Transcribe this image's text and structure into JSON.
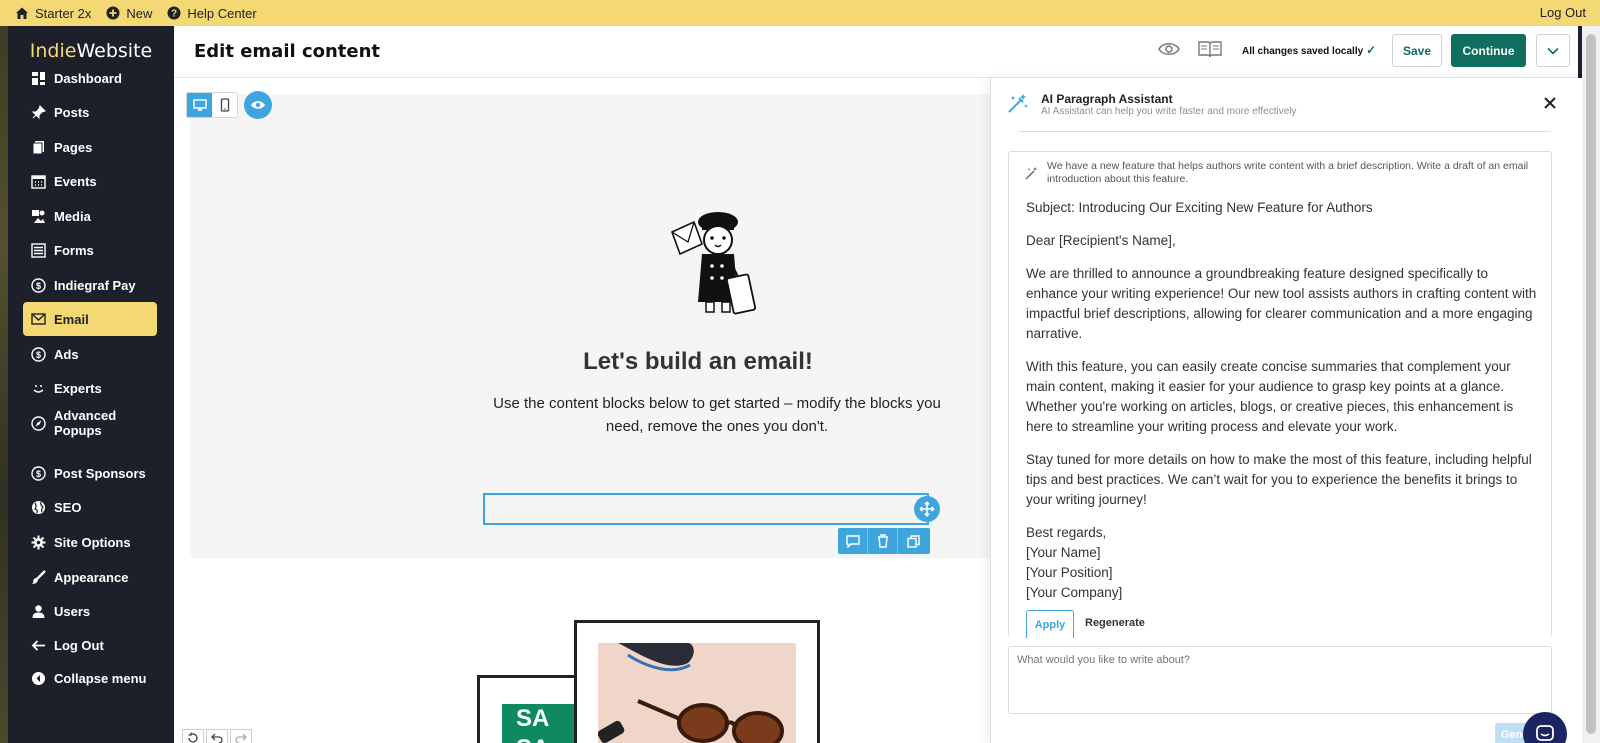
{
  "topbar": {
    "home_label": "Starter 2x",
    "new_label": "New",
    "help_label": "Help Center",
    "logout_label": "Log Out"
  },
  "brand": {
    "part1": "Indie",
    "part2": " Website"
  },
  "sidebar": {
    "items": [
      {
        "label": "Dashboard",
        "icon": "dashboard-icon"
      },
      {
        "label": "Posts",
        "icon": "pin-icon"
      },
      {
        "label": "Pages",
        "icon": "pages-icon"
      },
      {
        "label": "Events",
        "icon": "calendar-icon"
      },
      {
        "label": "Media",
        "icon": "media-icon"
      },
      {
        "label": "Forms",
        "icon": "forms-icon"
      },
      {
        "label": "Indiegraf Pay",
        "icon": "dollar-icon"
      },
      {
        "label": "Email",
        "icon": "envelope-icon",
        "active": true
      },
      {
        "label": "Ads",
        "icon": "dollar-icon"
      },
      {
        "label": "Experts",
        "icon": "smile-icon"
      },
      {
        "label": "Advanced\nPopups",
        "icon": "compass-icon"
      },
      {
        "label": "Post Sponsors",
        "icon": "dollar-icon"
      },
      {
        "label": "SEO",
        "icon": "globe-icon"
      },
      {
        "label": "Site Options",
        "icon": "gear-icon"
      },
      {
        "label": "Appearance",
        "icon": "brush-icon"
      },
      {
        "label": "Users",
        "icon": "user-icon"
      },
      {
        "label": "Log Out",
        "icon": "arrow-left-icon"
      },
      {
        "label": "Collapse menu",
        "icon": "collapse-icon"
      }
    ]
  },
  "header": {
    "title": "Edit email content",
    "saved_status": "All changes saved locally",
    "save_label": "Save",
    "continue_label": "Continue"
  },
  "email": {
    "heading": "Let's build an email!",
    "subtext": "Use the content blocks below to get started – modify the blocks you need, remove the ones you don't.",
    "photo_text": "SA\nSA"
  },
  "ai_panel": {
    "title": "AI Paragraph Assistant",
    "subtitle": "AI Assistant can help you write faster and more effectively",
    "prompt": "We have a new feature that helps authors write content with a brief description. Write a draft of an email introduction about this feature.",
    "response": [
      "Subject: Introducing Our Exciting New Feature for Authors",
      "Dear [Recipient's Name],",
      "We are thrilled to announce a groundbreaking feature designed specifically to enhance your writing experience! Our new tool assists authors in crafting content with impactful brief descriptions, allowing for clearer communication and a more engaging narrative.",
      "With this feature, you can easily create concise summaries that complement your main content, making it easier for your audience to grasp key points at a glance. Whether you're working on articles, blogs, or creative pieces, this enhancement is here to streamline your writing process and elevate your work.",
      "Stay tuned for more details on how to make the most of this feature, including helpful tips and best practices. We can’t wait for you to experience the benefits it brings to your writing journey!",
      "Best regards,\n[Your Name]\n[Your Position]\n[Your Company]"
    ],
    "apply_label": "Apply",
    "regenerate_label": "Regenerate",
    "input_placeholder": "What would you like to write about?",
    "generate_label": "Gene"
  },
  "colors": {
    "accent_yellow": "#f3d874",
    "primary_green": "#0f6e5d",
    "accent_blue": "#3ea6dd",
    "sidebar_bg": "#1d1f2a"
  }
}
